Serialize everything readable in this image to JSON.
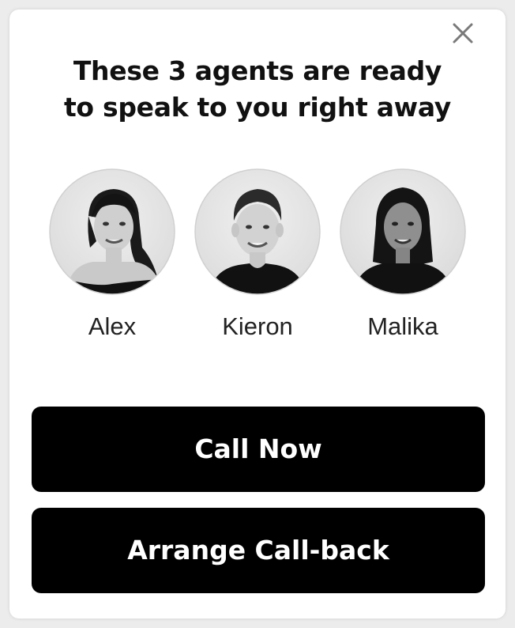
{
  "dialog": {
    "title_line1": "These 3 agents are ready",
    "title_line2": "to speak to you right away",
    "close_icon": "close-icon"
  },
  "agents": [
    {
      "name": "Alex",
      "avatar": "woman-long-dark-hair-photo"
    },
    {
      "name": "Kieron",
      "avatar": "man-short-hair-photo"
    },
    {
      "name": "Malika",
      "avatar": "woman-shoulder-length-hair-photo"
    }
  ],
  "actions": {
    "call_now_label": "Call Now",
    "arrange_callback_label": "Arrange Call-back"
  },
  "colors": {
    "button_bg": "#000000",
    "button_text": "#ffffff",
    "title_text": "#111111",
    "modal_bg": "#ffffff"
  }
}
